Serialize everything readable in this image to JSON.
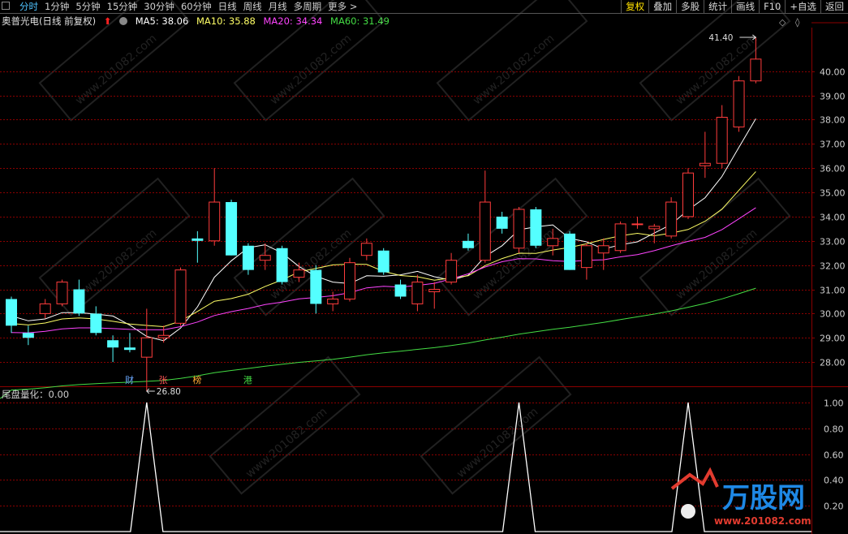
{
  "toolbar": {
    "tabs": [
      "分时",
      "1分钟",
      "5分钟",
      "15分钟",
      "30分钟",
      "60分钟",
      "日线",
      "周线",
      "月线",
      "多周期",
      "更多 >"
    ],
    "active_tab": "分时",
    "right_buttons": [
      "复权",
      "叠加",
      "多股",
      "统计",
      "画线",
      "F10",
      "+自选",
      "返回"
    ],
    "active_right": "复权"
  },
  "info": {
    "stock": "奥普光电(日线 前复权)",
    "ma5": "MA5: 38.06",
    "ma10": "MA10: 35.88",
    "ma20": "MA20: 34.34",
    "ma60": "MA60: 31.49"
  },
  "colors": {
    "bg": "#000000",
    "up": "#ff3c3c",
    "down": "#54ffff",
    "grid": "#8b0000",
    "ma5": "#ffffff",
    "ma10": "#ffff66",
    "ma20": "#ff44ff",
    "ma60": "#44dd44",
    "axis_text": "#d0d0d0"
  },
  "badges": [
    {
      "text": "财",
      "color": "#6aa8ff",
      "index": 7
    },
    {
      "text": "张",
      "color": "#ff5555",
      "index": 9
    },
    {
      "text": "榜",
      "color": "#ffaa33",
      "index": 11
    },
    {
      "text": "港",
      "color": "#44dd44",
      "index": 14
    }
  ],
  "annotations": {
    "high_label": "41.40",
    "low_label": "26.80"
  },
  "indicator": {
    "label": "尾盘量化：0.00",
    "axis": [
      "1.00",
      "0.80",
      "0.60",
      "0.40",
      "0.20"
    ]
  },
  "watermark": "www.201082.com",
  "logo": {
    "text": "万股网",
    "url": "www.201082.com"
  },
  "chart_data": {
    "type": "candlestick",
    "y_ticks": [
      "40.00",
      "39.00",
      "38.00",
      "37.00",
      "36.00",
      "35.00",
      "34.00",
      "33.00",
      "32.00",
      "31.00",
      "30.00",
      "29.00",
      "28.00"
    ],
    "ylim": [
      27.2,
      41.8
    ],
    "candles": [
      [
        30.6,
        29.5,
        30.7,
        29.2
      ],
      [
        29.2,
        29.0,
        29.5,
        28.7
      ],
      [
        30.0,
        30.4,
        30.6,
        29.8
      ],
      [
        30.4,
        31.3,
        31.4,
        30.3
      ],
      [
        31.0,
        30.0,
        31.4,
        29.9
      ],
      [
        30.0,
        29.2,
        30.3,
        29.1
      ],
      [
        28.9,
        28.6,
        29.1,
        28.0
      ],
      [
        28.6,
        28.5,
        29.2,
        28.4
      ],
      [
        28.2,
        29.0,
        30.2,
        26.8
      ],
      [
        29.0,
        29.1,
        29.5,
        28.8
      ],
      [
        29.6,
        31.8,
        31.9,
        29.5
      ],
      [
        33.1,
        33.0,
        33.4,
        32.1
      ],
      [
        33.0,
        34.6,
        36.0,
        32.8
      ],
      [
        34.6,
        32.4,
        34.7,
        32.4
      ],
      [
        32.8,
        31.8,
        32.9,
        31.6
      ],
      [
        32.2,
        32.4,
        32.9,
        31.8
      ],
      [
        32.7,
        31.3,
        32.8,
        31.2
      ],
      [
        31.5,
        31.8,
        32.1,
        31.3
      ],
      [
        31.8,
        30.4,
        32.0,
        30.0
      ],
      [
        30.4,
        30.6,
        30.9,
        30.1
      ],
      [
        30.6,
        32.1,
        32.3,
        30.5
      ],
      [
        32.4,
        32.9,
        33.1,
        32.2
      ],
      [
        32.6,
        31.7,
        32.7,
        31.6
      ],
      [
        31.2,
        30.7,
        31.4,
        30.6
      ],
      [
        30.4,
        31.3,
        31.6,
        30.1
      ],
      [
        30.9,
        31.0,
        31.3,
        30.2
      ],
      [
        31.3,
        32.2,
        32.5,
        31.2
      ],
      [
        33.0,
        32.7,
        33.3,
        32.6
      ],
      [
        32.2,
        34.6,
        35.9,
        32.1
      ],
      [
        34.0,
        33.5,
        34.2,
        33.3
      ],
      [
        32.7,
        34.3,
        34.4,
        32.5
      ],
      [
        34.3,
        32.8,
        34.4,
        32.7
      ],
      [
        32.8,
        33.1,
        33.5,
        32.4
      ],
      [
        33.3,
        31.8,
        33.4,
        31.8
      ],
      [
        31.9,
        32.8,
        32.9,
        31.4
      ],
      [
        32.5,
        32.8,
        33.1,
        31.8
      ],
      [
        32.6,
        33.7,
        33.8,
        32.5
      ],
      [
        33.7,
        33.7,
        34.0,
        33.5
      ],
      [
        33.5,
        33.6,
        33.7,
        32.9
      ],
      [
        33.2,
        34.6,
        34.8,
        33.1
      ],
      [
        34.0,
        35.8,
        36.0,
        33.9
      ],
      [
        36.1,
        36.2,
        37.5,
        35.6
      ],
      [
        36.2,
        38.1,
        38.6,
        36.0
      ],
      [
        37.7,
        39.6,
        39.8,
        37.5
      ],
      [
        39.6,
        40.5,
        41.4,
        39.5
      ]
    ],
    "indicator_spikes": [
      8,
      30,
      40
    ]
  }
}
